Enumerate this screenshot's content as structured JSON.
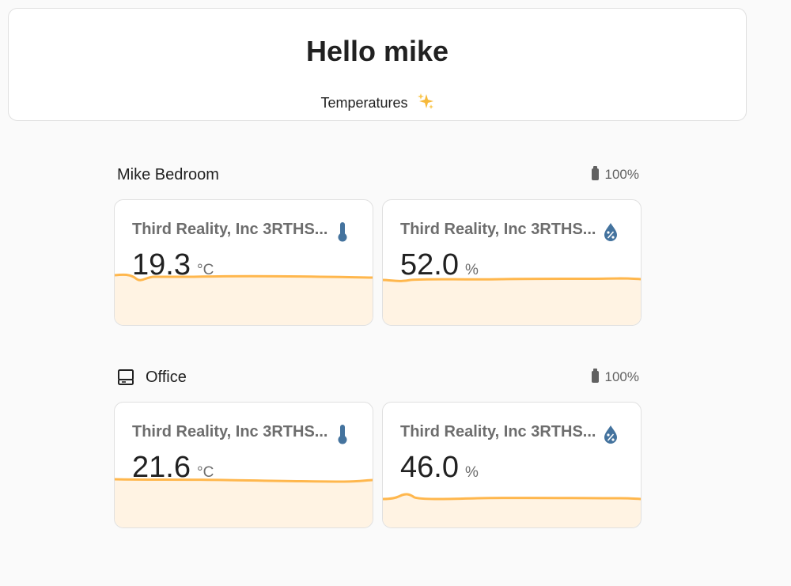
{
  "header": {
    "title": "Hello mike",
    "subtitle": "Temperatures"
  },
  "colors": {
    "accent_line": "#ffb74d",
    "accent_fill": "#fff3e3",
    "icon_blue": "#44739e"
  },
  "areas": [
    {
      "name": "Mike Bedroom",
      "icon": "none",
      "battery": "100%",
      "tiles": [
        {
          "name": "Third Reality, Inc 3RTHS...",
          "value": "19.3",
          "unit": "°C",
          "icon": "thermometer-icon"
        },
        {
          "name": "Third Reality, Inc 3RTHS...",
          "value": "52.0",
          "unit": "%",
          "icon": "water-percent-icon"
        }
      ]
    },
    {
      "name": "Office",
      "icon": "desktop-tower-monitor-icon",
      "battery": "100%",
      "tiles": [
        {
          "name": "Third Reality, Inc 3RTHS...",
          "value": "21.6",
          "unit": "°C",
          "icon": "thermometer-icon"
        },
        {
          "name": "Third Reality, Inc 3RTHS...",
          "value": "46.0",
          "unit": "%",
          "icon": "water-percent-icon"
        }
      ]
    }
  ]
}
